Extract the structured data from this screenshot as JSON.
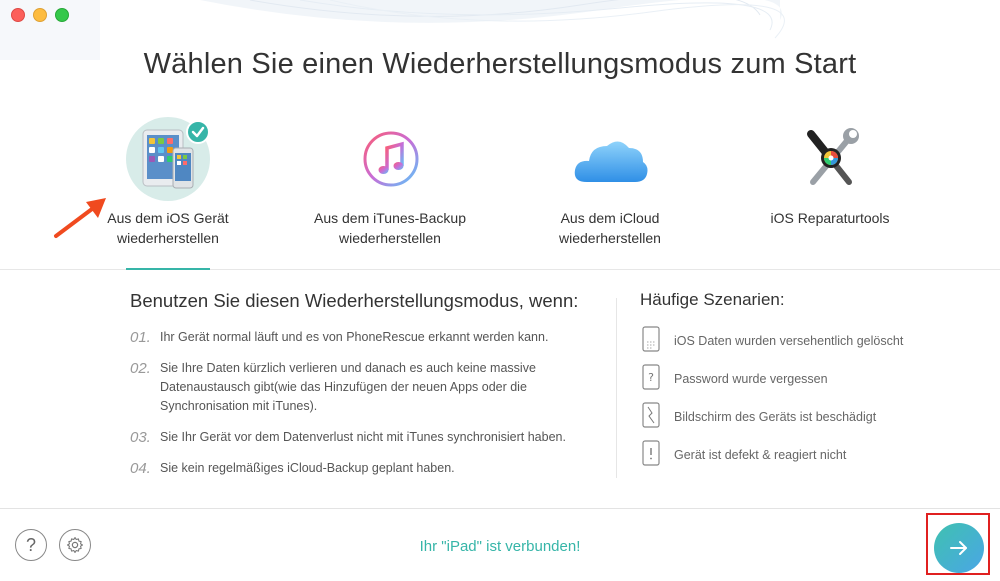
{
  "window": {
    "title": "Wählen Sie einen Wiederherstellungsmodus zum Start"
  },
  "modes": [
    {
      "line1": "Aus dem iOS Gerät",
      "line2": "wiederherstellen",
      "icon": "ipad-iphone-icon",
      "active": true
    },
    {
      "line1": "Aus dem iTunes-Backup",
      "line2": "wiederherstellen",
      "icon": "itunes-icon",
      "active": false
    },
    {
      "line1": "Aus dem iCloud",
      "line2": "wiederherstellen",
      "icon": "icloud-icon",
      "active": false
    },
    {
      "line1": "iOS Reparaturtools",
      "line2": "",
      "icon": "repair-tools-icon",
      "active": false
    }
  ],
  "usage": {
    "heading": "Benutzen Sie diesen Wiederherstellungsmodus, wenn:",
    "steps": [
      {
        "num": "01.",
        "text": "Ihr Gerät normal läuft und es von PhoneRescue erkannt werden kann."
      },
      {
        "num": "02.",
        "text": "Sie Ihre Daten kürzlich verlieren und danach es auch keine massive Datenaustausch gibt(wie das Hinzufügen der neuen Apps oder die Synchronisation mit iTunes)."
      },
      {
        "num": "03.",
        "text": "Sie Ihr Gerät vor dem Datenverlust nicht mit iTunes synchronisiert haben."
      },
      {
        "num": "04.",
        "text": "Sie kein regelmäßiges iCloud-Backup geplant haben."
      }
    ]
  },
  "scenarios": {
    "heading": "Häufige Szenarien:",
    "items": [
      {
        "text": "iOS Daten wurden versehentlich gelöscht",
        "icon": "deleted-data-phone-icon"
      },
      {
        "text": "Password wurde vergessen",
        "icon": "forgot-password-phone-icon"
      },
      {
        "text": "Bildschirm des Geräts ist beschädigt",
        "icon": "broken-screen-phone-icon"
      },
      {
        "text": "Gerät ist defekt & reagiert nicht",
        "icon": "unresponsive-phone-icon"
      }
    ]
  },
  "footer": {
    "help_symbol": "?",
    "status": "Ihr \"iPad\" ist verbunden!"
  },
  "colors": {
    "accent": "#36b5a8",
    "next_gradient_start": "#3fc1b0",
    "next_gradient_end": "#4aa6e6",
    "annotation_red": "#e02020"
  }
}
